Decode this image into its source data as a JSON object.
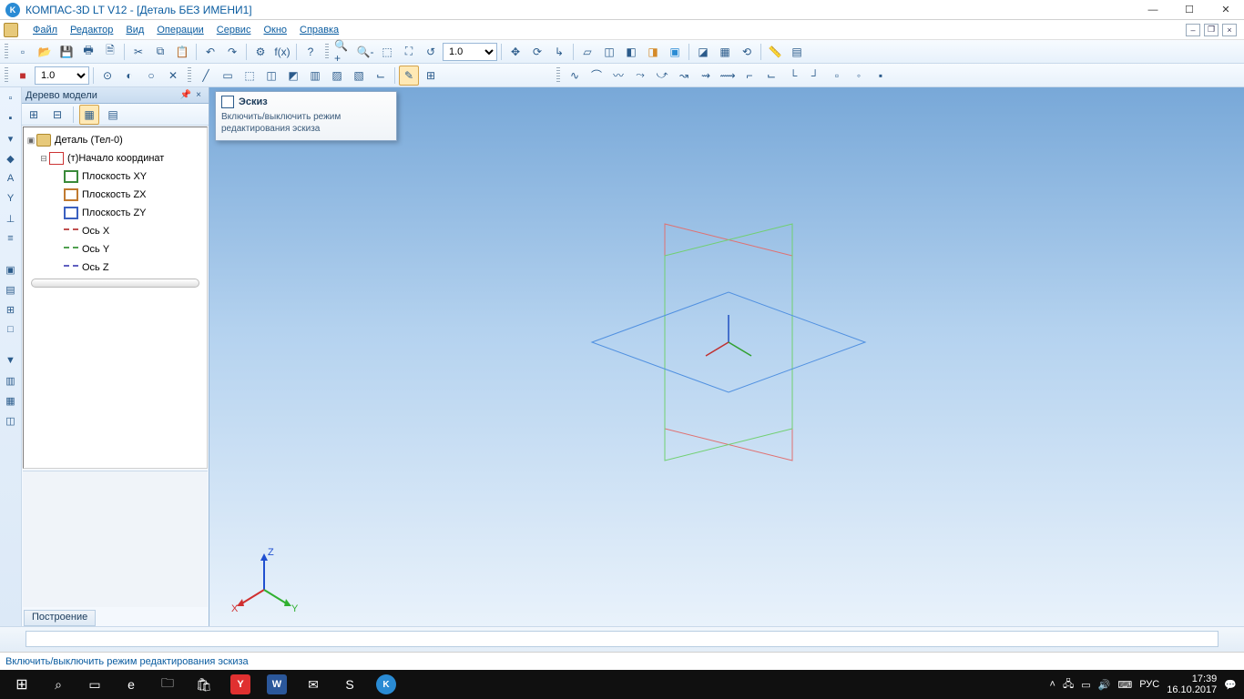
{
  "window": {
    "title": "КОМПАС-3D LT V12 - [Деталь БЕЗ ИМЕНИ1]"
  },
  "menu": {
    "items": [
      "Файл",
      "Редактор",
      "Вид",
      "Операции",
      "Сервис",
      "Окно",
      "Справка"
    ]
  },
  "toolbar1": {
    "scale_combo": "1.0"
  },
  "toolbar2": {
    "step_combo": "1.0"
  },
  "tree": {
    "title": "Дерево модели",
    "root": "Деталь (Тел-0)",
    "origin": "(т)Начало координат",
    "children": [
      {
        "label": "Плоскость XY",
        "icon": "icon-plane-xy"
      },
      {
        "label": "Плоскость ZX",
        "icon": "icon-plane-zx"
      },
      {
        "label": "Плоскость ZY",
        "icon": "icon-plane-zy"
      },
      {
        "label": "Ось X",
        "icon": "icon-axis-x"
      },
      {
        "label": "Ось Y",
        "icon": "icon-axis-y"
      },
      {
        "label": "Ось Z",
        "icon": "icon-axis-z"
      }
    ],
    "tab": "Построение"
  },
  "tooltip": {
    "title": "Эскиз",
    "body": "Включить/выключить режим редактирования эскиза"
  },
  "triad": {
    "x": "X",
    "y": "Y",
    "z": "Z"
  },
  "status": {
    "text": "Включить/выключить режим редактирования эскиза"
  },
  "taskbar": {
    "lang": "РУС",
    "time": "17:39",
    "date": "16.10.2017"
  }
}
